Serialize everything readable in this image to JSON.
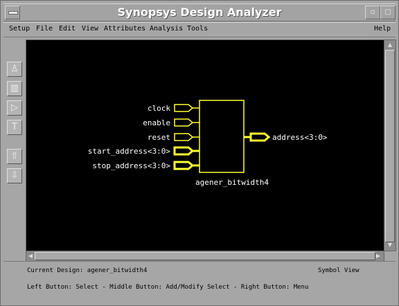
{
  "window": {
    "title": "Synopsys Design Analyzer",
    "buttons": [
      "▫",
      "▢"
    ]
  },
  "menu": {
    "items": [
      "Setup",
      "File",
      "Edit",
      "View",
      "Attributes",
      "Analysis",
      "Tools"
    ],
    "help": "Help"
  },
  "toolbar": {
    "icons": [
      "design-icon",
      "frame-icon",
      "gate-icon",
      "text-icon",
      "up-arrow-icon",
      "down-arrow-icon"
    ]
  },
  "schematic": {
    "inputs": [
      "clock",
      "enable",
      "reset",
      "start_address<3:0>",
      "stop_address<3:0>"
    ],
    "output": "address<3:0>",
    "instance_name": "agener_bitwidth4",
    "colors": {
      "background": "#000000",
      "wire": "#ffff33",
      "text": "#ffffff"
    }
  },
  "status": {
    "current_design": "Current Design: agener_bitwidth4",
    "view": "Symbol View",
    "hint": "Left Button: Select   -   Middle Button: Add/Modify Select   -   Right Button: Menu"
  }
}
